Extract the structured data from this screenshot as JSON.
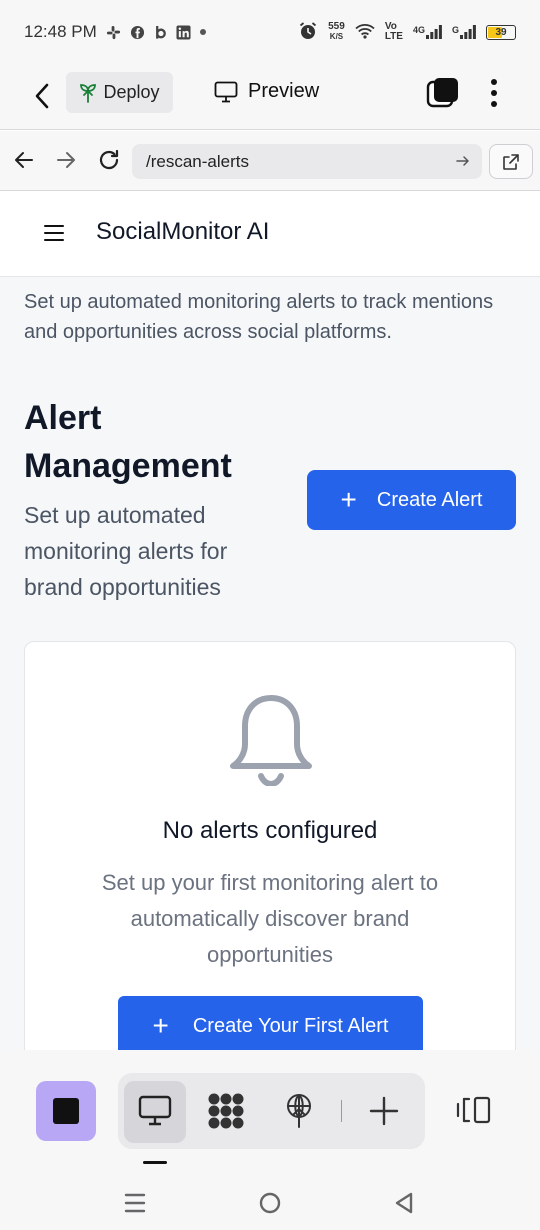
{
  "status_bar": {
    "time": "12:48 PM",
    "net_speed_value": "559",
    "net_speed_unit": "K/S",
    "volte_top": "Vo",
    "volte_bottom": "LTE",
    "network_4g": "4G",
    "network_g": "G",
    "battery_level": "39"
  },
  "app_header": {
    "deploy_label": "Deploy",
    "preview_label": "Preview"
  },
  "browser": {
    "url": "/rescan-alerts"
  },
  "site": {
    "brand": "SocialMonitor AI",
    "intro": "Set up automated monitoring alerts to track mentions and opportunities across social platforms.",
    "heading": "Alert Management",
    "subheading": "Set up automated monitoring alerts for brand opportunities",
    "create_button": "Create Alert",
    "empty_state": {
      "title": "No alerts configured",
      "description": "Set up your first monitoring alert to automatically discover brand opportunities",
      "button": "Create Your First Alert"
    }
  },
  "colors": {
    "primary": "#2563eb",
    "stop_button": "#b8a7f5",
    "deploy_icon": "#1a7f37",
    "battery": "#f5c518"
  },
  "icons": {
    "back": "chevron-left-icon",
    "deploy": "sprout-icon",
    "preview": "monitor-icon",
    "tabs": "tabs-icon",
    "more": "more-vertical-icon",
    "nav_back": "arrow-left-icon",
    "nav_forward": "arrow-right-icon",
    "reload": "reload-icon",
    "go": "arrow-right-icon",
    "external": "external-link-icon",
    "menu": "hamburger-icon",
    "empty": "bell-icon",
    "add": "plus-icon",
    "toolbar": [
      "stop-icon",
      "monitor-icon",
      "grid-icon",
      "sprout-icon",
      "plus-icon",
      "panel-icon"
    ],
    "system": [
      "recents-icon",
      "home-icon",
      "back-icon"
    ]
  }
}
